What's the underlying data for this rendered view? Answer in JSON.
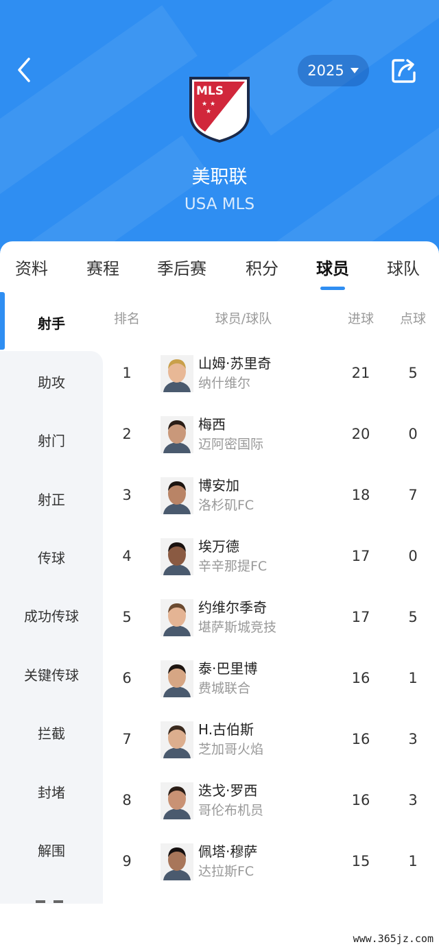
{
  "header": {
    "season": "2025",
    "league_name": "美职联",
    "league_name_en": "USA MLS",
    "logo_text": "MLS",
    "bg_color": "#2f8ef2"
  },
  "tabs": [
    {
      "label": "资料",
      "active": false
    },
    {
      "label": "赛程",
      "active": false
    },
    {
      "label": "季后赛",
      "active": false
    },
    {
      "label": "积分",
      "active": false
    },
    {
      "label": "球员",
      "active": true
    },
    {
      "label": "球队",
      "active": false
    }
  ],
  "categories": [
    {
      "label": "射手",
      "active": true
    },
    {
      "label": "助攻",
      "active": false
    },
    {
      "label": "射门",
      "active": false
    },
    {
      "label": "射正",
      "active": false
    },
    {
      "label": "传球",
      "active": false
    },
    {
      "label": "成功传球",
      "active": false
    },
    {
      "label": "关键传球",
      "active": false
    },
    {
      "label": "拦截",
      "active": false
    },
    {
      "label": "封堵",
      "active": false
    },
    {
      "label": "解围",
      "active": false
    }
  ],
  "table": {
    "headers": {
      "rank": "排名",
      "player": "球员/球队",
      "goals": "进球",
      "penalties": "点球"
    },
    "rows": [
      {
        "rank": "1",
        "name": "山姆·苏里奇",
        "team": "纳什维尔",
        "goals": "21",
        "penalties": "5"
      },
      {
        "rank": "2",
        "name": "梅西",
        "team": "迈阿密国际",
        "goals": "20",
        "penalties": "0"
      },
      {
        "rank": "3",
        "name": "博安加",
        "team": "洛杉矶FC",
        "goals": "18",
        "penalties": "7"
      },
      {
        "rank": "4",
        "name": "埃万德",
        "team": "辛辛那提FC",
        "goals": "17",
        "penalties": "0"
      },
      {
        "rank": "5",
        "name": "约维尔季奇",
        "team": "堪萨斯城竞技",
        "goals": "17",
        "penalties": "5"
      },
      {
        "rank": "6",
        "name": "泰·巴里博",
        "team": "费城联合",
        "goals": "16",
        "penalties": "1"
      },
      {
        "rank": "7",
        "name": "H.古伯斯",
        "team": "芝加哥火焰",
        "goals": "16",
        "penalties": "3"
      },
      {
        "rank": "8",
        "name": "迭戈·罗西",
        "team": "哥伦布机员",
        "goals": "16",
        "penalties": "3"
      },
      {
        "rank": "9",
        "name": "佩塔·穆萨",
        "team": "达拉斯FC",
        "goals": "15",
        "penalties": "1"
      }
    ]
  },
  "watermark": "www.365jz.com",
  "colors": {
    "accent": "#2f8ef2",
    "muted": "#999999",
    "sidebar_bg": "#f3f5f8"
  }
}
